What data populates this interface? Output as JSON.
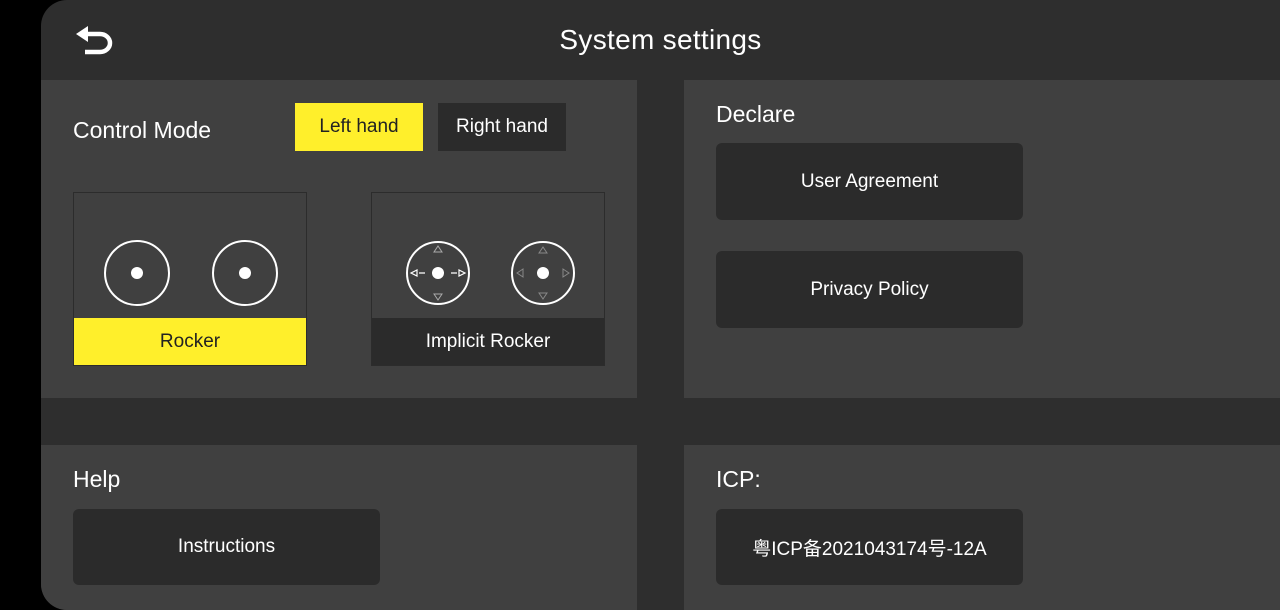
{
  "header": {
    "title": "System settings",
    "back_icon": "back-arrow-icon"
  },
  "control": {
    "title": "Control Mode",
    "hands": [
      {
        "label": "Left hand",
        "selected": true
      },
      {
        "label": "Right hand",
        "selected": false
      }
    ],
    "modes": [
      {
        "label": "Rocker",
        "selected": true
      },
      {
        "label": "Implicit Rocker",
        "selected": false
      }
    ]
  },
  "declare": {
    "title": "Declare",
    "user_agreement": "User Agreement",
    "privacy_policy": "Privacy Policy"
  },
  "help": {
    "title": "Help",
    "instructions": "Instructions"
  },
  "icp": {
    "title": "ICP:",
    "value": "粤ICP备2021043174号-12A"
  },
  "colors": {
    "accent": "#ffef2b",
    "screen_bg": "#2e2e2e",
    "panel_bg": "#404040",
    "button_bg": "#2b2b2b",
    "text": "#ffffff"
  }
}
